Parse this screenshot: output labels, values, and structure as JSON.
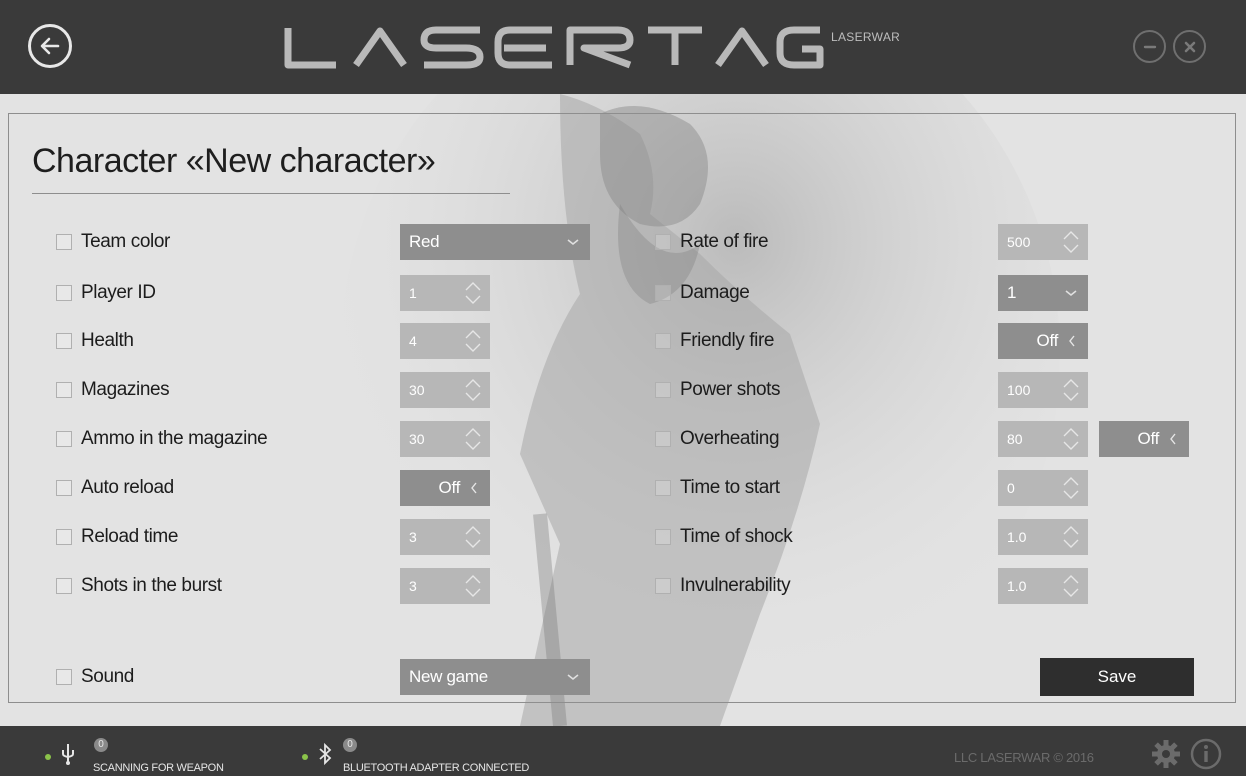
{
  "app": {
    "logo_text": "LASERTAG",
    "logo_sub": "LASERWAR"
  },
  "page": {
    "title": "Character «New character»"
  },
  "left_fields": [
    {
      "label": "Team color",
      "control": "dropdown",
      "value": "Red"
    },
    {
      "label": "Player ID",
      "control": "spinner",
      "value": "1"
    },
    {
      "label": "Health",
      "control": "spinner",
      "value": "4"
    },
    {
      "label": "Magazines",
      "control": "spinner",
      "value": "30"
    },
    {
      "label": "Ammo in the magazine",
      "control": "spinner",
      "value": "30"
    },
    {
      "label": "Auto reload",
      "control": "toggle",
      "value": "Off"
    },
    {
      "label": "Reload time",
      "control": "spinner",
      "value": "3"
    },
    {
      "label": "Shots in the burst",
      "control": "spinner",
      "value": "3"
    }
  ],
  "right_fields": [
    {
      "label": "Rate of fire",
      "control": "spinner",
      "value": "500"
    },
    {
      "label": "Damage",
      "control": "dropdown",
      "value": "1"
    },
    {
      "label": "Friendly fire",
      "control": "toggle",
      "value": "Off"
    },
    {
      "label": "Power shots",
      "control": "spinner",
      "value": "100"
    },
    {
      "label": "Overheating",
      "control": "spinner",
      "value": "80",
      "extra_toggle": "Off"
    },
    {
      "label": "Time to start",
      "control": "spinner",
      "value": "0"
    },
    {
      "label": "Time of shock",
      "control": "spinner",
      "value": "1.0"
    },
    {
      "label": "Invulnerability",
      "control": "spinner",
      "value": "1.0"
    }
  ],
  "sound": {
    "label": "Sound",
    "value": "New game"
  },
  "actions": {
    "save_label": "Save"
  },
  "status": {
    "weapon": {
      "count": "0",
      "text": "SCANNING FOR WEAPON",
      "icon": "usb-icon"
    },
    "bluetooth": {
      "count": "0",
      "text": "BLUETOOTH ADAPTER CONNECTED",
      "icon": "bluetooth-icon"
    },
    "copyright": "LLC LASERWAR © 2016"
  },
  "colors": {
    "titlebar": "#3a3a3a",
    "control_bg": "#8e8e8e",
    "control_faded": "#b7b7b7",
    "save_bg": "#2e2e2e",
    "status_dot": "#8bc34a"
  }
}
